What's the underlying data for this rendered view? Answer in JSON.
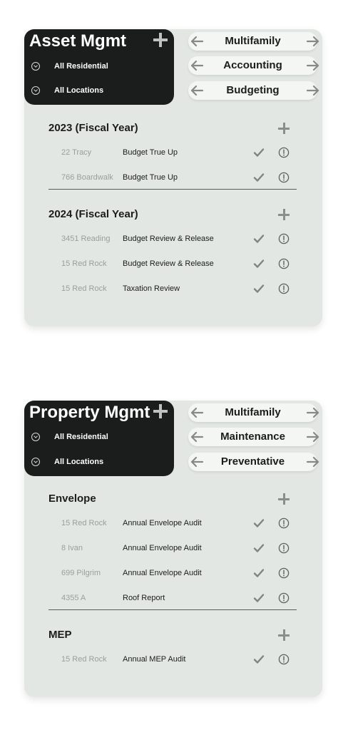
{
  "asset_card": {
    "title": "Asset Mgmt",
    "filters": [
      "All Residential",
      "All Locations"
    ],
    "selectors": [
      "Multifamily",
      "Accounting",
      "Budgeting"
    ],
    "sections": [
      {
        "title": "2023 (Fiscal Year)",
        "rows": [
          {
            "location": "22 Tracy",
            "task": "Budget True Up"
          },
          {
            "location": "766 Boardwalk",
            "task": "Budget True Up"
          }
        ]
      },
      {
        "title": "2024 (Fiscal Year)",
        "rows": [
          {
            "location": "3451 Reading",
            "task": "Budget Review & Release"
          },
          {
            "location": "15 Red Rock",
            "task": "Budget Review & Release"
          },
          {
            "location": "15 Red Rock",
            "task": "Taxation Review"
          }
        ]
      }
    ]
  },
  "property_card": {
    "title": "Property Mgmt",
    "filters": [
      "All Residential",
      "All Locations"
    ],
    "selectors": [
      "Multifamily",
      "Maintenance",
      "Preventative"
    ],
    "sections": [
      {
        "title": "Envelope",
        "rows": [
          {
            "location": "15 Red Rock",
            "task": "Annual Envelope Audit"
          },
          {
            "location": "8 Ivan",
            "task": "Annual Envelope Audit"
          },
          {
            "location": "699 Pilgrim",
            "task": "Annual Envelope Audit"
          },
          {
            "location": "4355 A",
            "task": "Roof Report"
          }
        ]
      },
      {
        "title": "MEP",
        "rows": [
          {
            "location": "15 Red Rock",
            "task": "Annual MEP Audit"
          }
        ]
      }
    ]
  },
  "colors": {
    "header": "#1b1d1d",
    "card": "#e3e7e4",
    "pill": "#f4f6f4",
    "icon": "#8a8e8c"
  }
}
